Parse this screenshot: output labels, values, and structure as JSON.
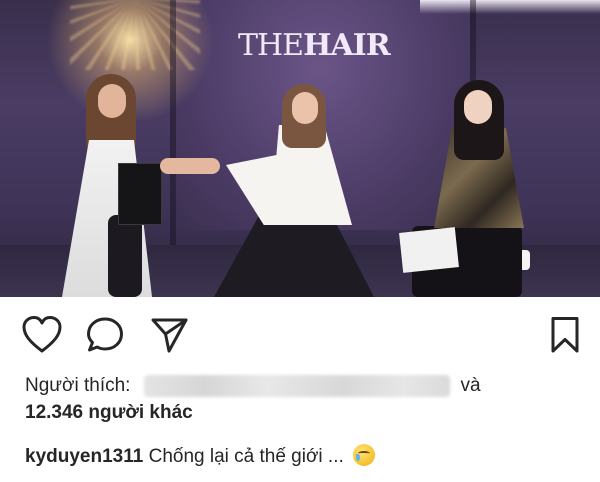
{
  "photo": {
    "brand_light": "THE",
    "brand_bold": "HAIR"
  },
  "actions": {
    "like_icon": "heart-outline-icon",
    "comment_icon": "comment-bubble-icon",
    "share_icon": "paper-plane-icon",
    "save_icon": "bookmark-icon"
  },
  "likes": {
    "prefix": "Người thích:",
    "and": "và",
    "count": "12.346 người khác"
  },
  "caption": {
    "username": "kyduyen1311",
    "text": "Chống lại cả thế giới ...",
    "emoji": "crying-face-emoji"
  },
  "colors": {
    "text": "#262626",
    "background": "#ffffff"
  }
}
